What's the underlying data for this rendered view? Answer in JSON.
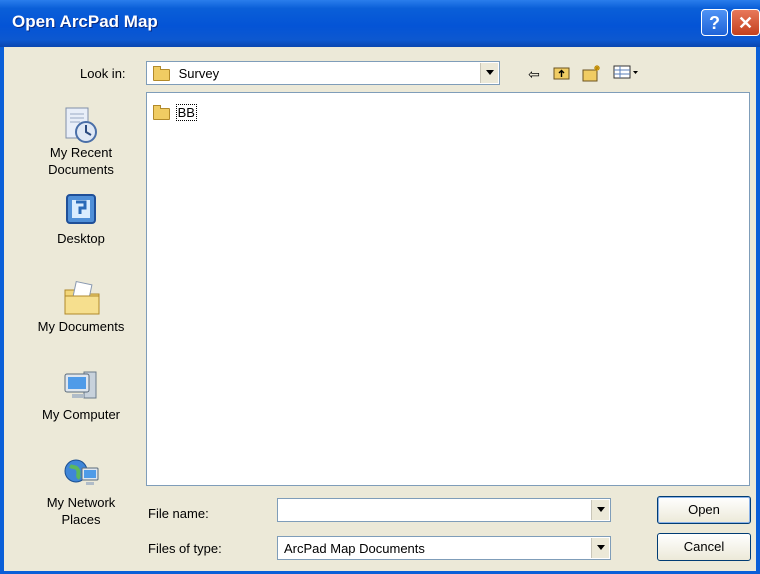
{
  "window": {
    "title": "Open ArcPad Map"
  },
  "titlebar": {
    "help_icon": "help-icon",
    "close_icon": "close-icon"
  },
  "look_in": {
    "label": "Look in:",
    "value": "Survey"
  },
  "toolbar": {
    "icons": [
      "back-arrow-icon",
      "up-folder-icon",
      "new-folder-icon",
      "view-menu-icon"
    ]
  },
  "places": [
    {
      "label": "My Recent Documents",
      "icon": "recent-documents-icon"
    },
    {
      "label": "Desktop",
      "icon": "desktop-icon"
    },
    {
      "label": "My Documents",
      "icon": "my-documents-icon"
    },
    {
      "label": "My Computer",
      "icon": "my-computer-icon"
    },
    {
      "label": "My Network Places",
      "icon": "network-places-icon"
    }
  ],
  "files": [
    {
      "name": "BB",
      "icon": "folder-icon"
    }
  ],
  "file_name": {
    "label": "File name:",
    "value": ""
  },
  "file_type": {
    "label": "Files of type:",
    "value": "ArcPad Map Documents"
  },
  "buttons": {
    "open": "Open",
    "cancel": "Cancel"
  }
}
